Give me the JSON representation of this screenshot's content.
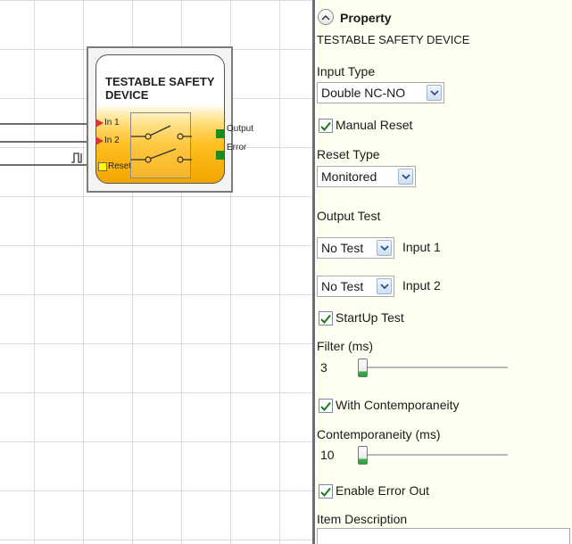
{
  "block": {
    "title": "TESTABLE SAFETY DEVICE",
    "inputs": [
      "In 1",
      "In 2",
      "Reset"
    ],
    "outputs": [
      "Output",
      "Error"
    ]
  },
  "panel": {
    "title": "Property",
    "device_name": "TESTABLE SAFETY DEVICE",
    "input_type_label": "Input Type",
    "input_type_value": "Double NC-NO",
    "manual_reset_label": "Manual Reset",
    "manual_reset_checked": true,
    "reset_type_label": "Reset Type",
    "reset_type_value": "Monitored",
    "output_test_label": "Output Test",
    "test1_value": "No Test",
    "test1_label": "Input 1",
    "test2_value": "No Test",
    "test2_label": "Input 2",
    "startup_test_label": "StartUp Test",
    "startup_test_checked": true,
    "filter_label": "Filter (ms)",
    "filter_value": "3",
    "contemporaneity_check_label": "With Contemporaneity",
    "contemporaneity_checked": true,
    "contemporaneity_label": "Contemporaneity (ms)",
    "contemporaneity_value": "10",
    "enable_error_out_label": "Enable Error Out",
    "enable_error_out_checked": true,
    "item_description_label": "Item Description",
    "item_description_value": ""
  },
  "colors": {
    "accent_check": "#1a7a1a",
    "pin_arrow": "#e0303a",
    "output_pin": "#1e8b1e",
    "panel_bg": "#fffff2"
  }
}
